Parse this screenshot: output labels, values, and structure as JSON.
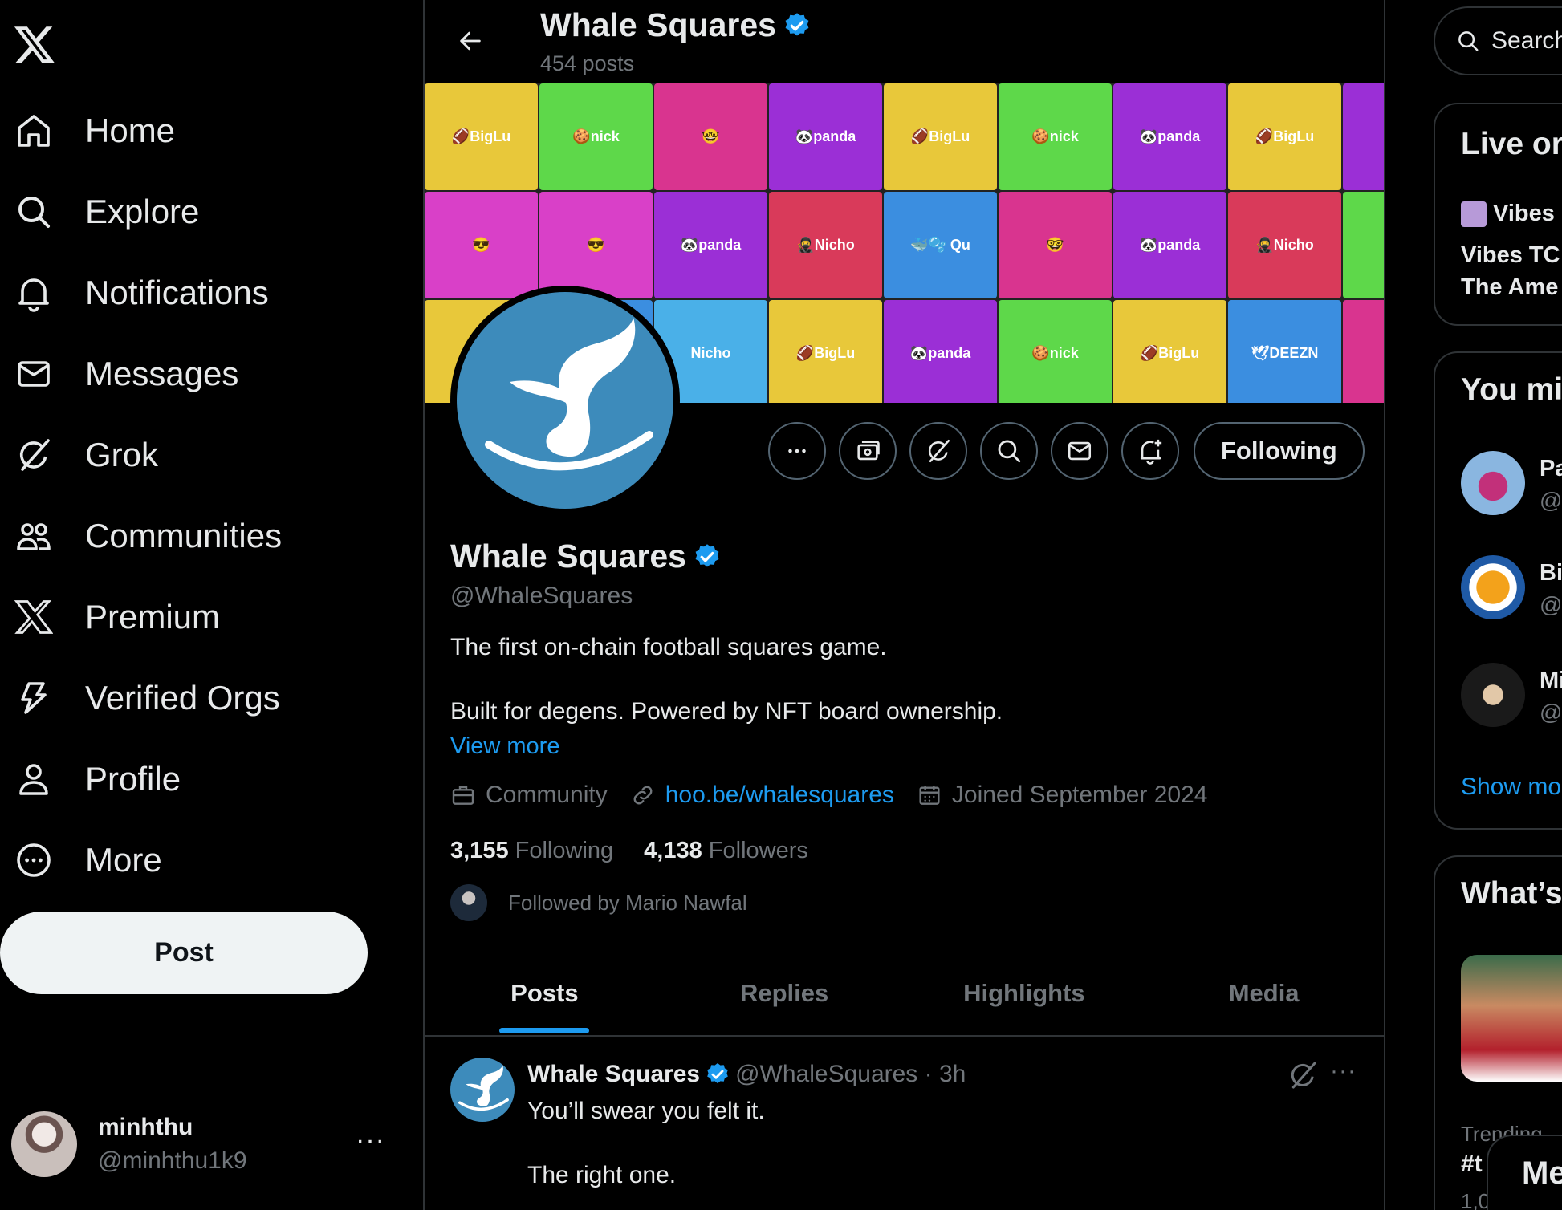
{
  "nav": {
    "items": [
      {
        "label": "Home",
        "icon": "home-icon"
      },
      {
        "label": "Explore",
        "icon": "search-icon"
      },
      {
        "label": "Notifications",
        "icon": "bell-icon"
      },
      {
        "label": "Messages",
        "icon": "envelope-icon"
      },
      {
        "label": "Grok",
        "icon": "grok-icon"
      },
      {
        "label": "Communities",
        "icon": "people-icon"
      },
      {
        "label": "Premium",
        "icon": "x-logo-icon"
      },
      {
        "label": "Verified Orgs",
        "icon": "lightning-icon"
      },
      {
        "label": "Profile",
        "icon": "person-icon"
      },
      {
        "label": "More",
        "icon": "more-circle-icon"
      }
    ],
    "post_label": "Post"
  },
  "account": {
    "name": "minhthu",
    "handle": "@minhthu1k9",
    "more": "···"
  },
  "header": {
    "title": "Whale Squares",
    "post_count": "454 posts"
  },
  "banner": {
    "tiles": [
      [
        "🏈BigLu",
        "🍪nick",
        "🤓",
        "🐼panda",
        "🏈BigLu",
        "🍪nick",
        "🐼panda",
        "🏈BigLu",
        "🐼"
      ],
      [
        "😎",
        "😎",
        "🐼panda",
        "🥷Nicho",
        "🐳🫧 Qu",
        "🤓",
        "🐼panda",
        "🥷Nicho",
        "🍪"
      ],
      [
        "🏈",
        "",
        "Nicho",
        "🏈BigLu",
        "🐼panda",
        "🍪nick",
        "🏈BigLu",
        "🕊DEEZN",
        ""
      ]
    ],
    "colors": {
      "yellow": "#e8c83a",
      "green": "#5ed84a",
      "magenta": "#d9348f",
      "purple": "#9b2fd6",
      "pink": "#d940c8",
      "red": "#d93a5a",
      "blue": "#3b8ee0",
      "lightblue": "#4ab0e8"
    }
  },
  "profile": {
    "name": "Whale Squares",
    "handle": "@WhaleSquares",
    "bio_line1": "The first on-chain football squares game.",
    "bio_line2": "Built for degens. Powered by NFT board ownership.",
    "view_more": "View more",
    "category": "Community",
    "link": "hoo.be/whalesquares",
    "joined": "Joined September 2024",
    "following_count": "3,155",
    "following_label": "Following",
    "followers_count": "4,138",
    "followers_label": "Followers",
    "followed_by": "Followed by Mario Nawfal",
    "follow_button": "Following",
    "accent": "#1d9bf0"
  },
  "tabs": [
    "Posts",
    "Replies",
    "Highlights",
    "Media"
  ],
  "tweet": {
    "name": "Whale Squares",
    "meta": "@WhaleSquares · 3h",
    "line1": "You’ll swear you felt it.",
    "line2": "The right one.",
    "more": "···"
  },
  "right": {
    "search_placeholder": "Search",
    "live_title": "Live or",
    "vibes_label": "Vibes (",
    "vibes_line1": "Vibes TC",
    "vibes_line2": "The Ame",
    "you_might_title": "You mi",
    "who": [
      {
        "name": "Pa",
        "handle": "@"
      },
      {
        "name": "Bi",
        "handle": "@"
      },
      {
        "name": "Mi",
        "handle": "@"
      }
    ],
    "show_more": "Show mo",
    "whats_title": "What’s",
    "trend_label": "Trending",
    "trend_tag": "#t",
    "trend_count": "1,0",
    "messages_label": "Me"
  }
}
